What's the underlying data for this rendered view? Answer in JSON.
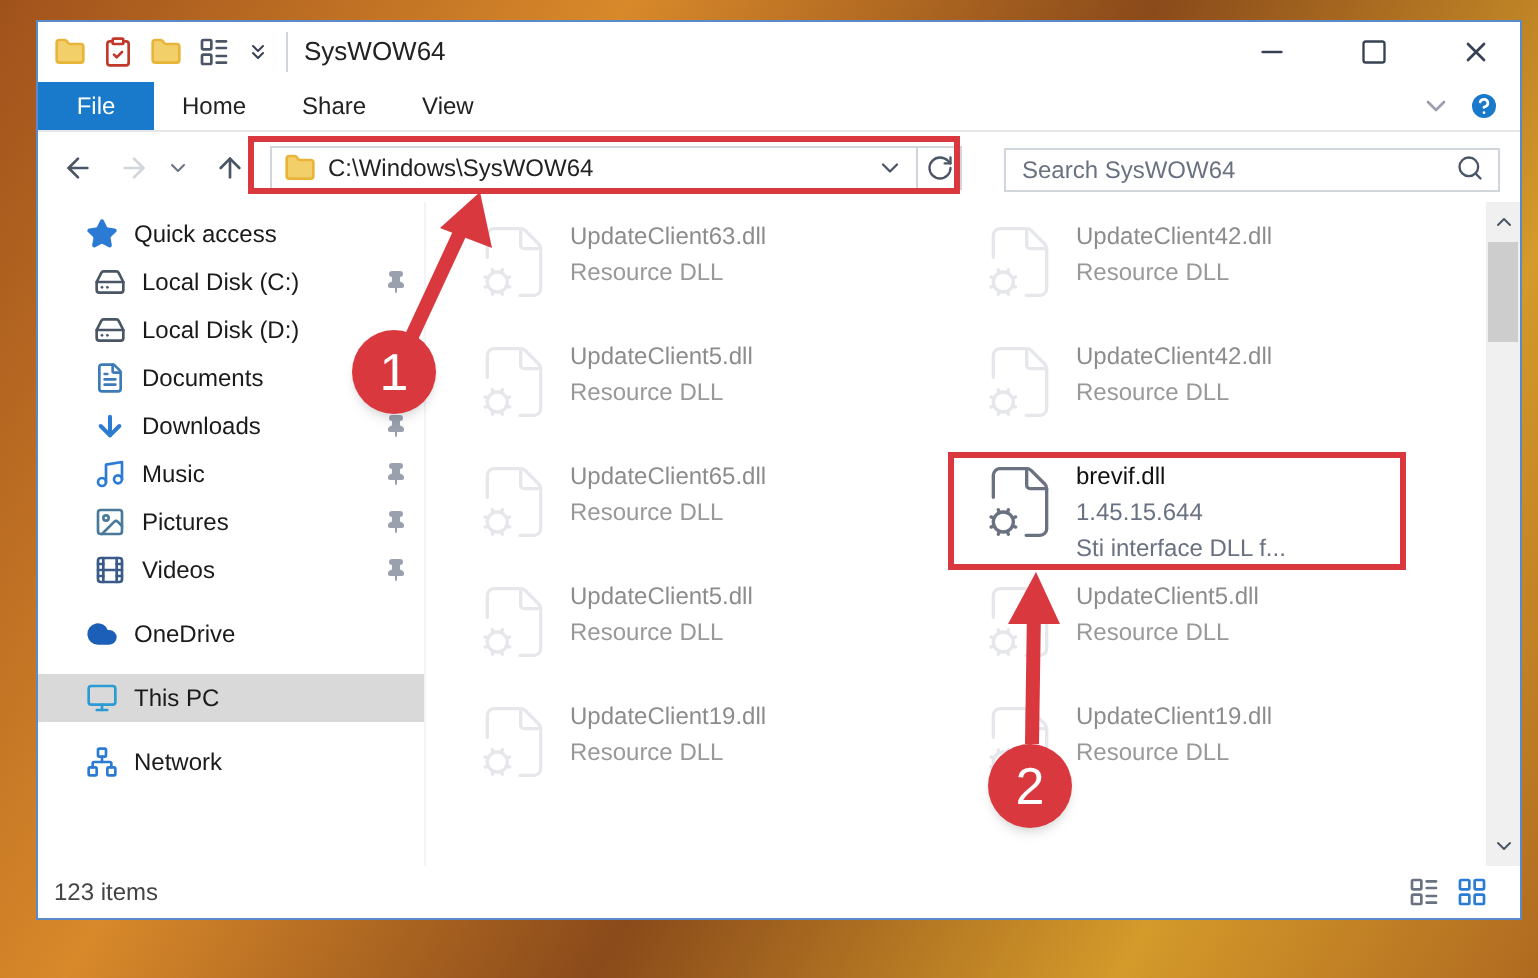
{
  "window": {
    "title": "SysWOW64"
  },
  "ribbon_tabs": [
    {
      "label": "File",
      "kind": "file"
    },
    {
      "label": "Home",
      "kind": "tab"
    },
    {
      "label": "Share",
      "kind": "tab"
    },
    {
      "label": "View",
      "kind": "tab"
    }
  ],
  "address_bar": {
    "path": "C:\\Windows\\SysWOW64"
  },
  "search": {
    "placeholder": "Search SysWOW64"
  },
  "sidebar": {
    "items": [
      {
        "label": "Quick access",
        "kind": "star",
        "selected": false,
        "children": [
          {
            "label": "Local Disk (C:)",
            "kind": "drive",
            "pinned": true,
            "selected": false
          },
          {
            "label": "Local Disk (D:)",
            "kind": "drive",
            "pinned": false,
            "selected": false
          },
          {
            "label": "Documents",
            "kind": "documents",
            "pinned": false,
            "selected": false
          },
          {
            "label": "Downloads",
            "kind": "downloads",
            "pinned": true,
            "selected": false
          },
          {
            "label": "Music",
            "kind": "music",
            "pinned": true,
            "selected": false
          },
          {
            "label": "Pictures",
            "kind": "pictures",
            "pinned": true,
            "selected": false
          },
          {
            "label": "Videos",
            "kind": "videos",
            "pinned": true,
            "selected": false
          }
        ]
      },
      {
        "label": "OneDrive",
        "kind": "cloud",
        "selected": false
      },
      {
        "label": "This PC",
        "kind": "pc",
        "selected": true
      },
      {
        "label": "Network",
        "kind": "network",
        "selected": false
      }
    ]
  },
  "files": [
    {
      "name": "UpdateClient63.dll",
      "description": "Resource DLL",
      "dimmed": true
    },
    {
      "name": "UpdateClient42.dll",
      "description": "Resource DLL",
      "dimmed": true
    },
    {
      "name": "UpdateClient5.dll",
      "description": "Resource DLL",
      "dimmed": true
    },
    {
      "name": "UpdateClient42.dll",
      "description": "Resource DLL",
      "dimmed": true
    },
    {
      "name": "UpdateClient65.dll",
      "description": "Resource DLL",
      "dimmed": true
    },
    {
      "name": "brevif.dll",
      "version": "1.45.15.644",
      "description": "Sti interface DLL f...",
      "dimmed": false
    },
    {
      "name": "UpdateClient5.dll",
      "description": "Resource DLL",
      "dimmed": true
    },
    {
      "name": "UpdateClient5.dll",
      "description": "Resource DLL",
      "dimmed": true
    },
    {
      "name": "UpdateClient19.dll",
      "description": "Resource DLL",
      "dimmed": true
    },
    {
      "name": "UpdateClient19.dll",
      "description": "Resource DLL",
      "dimmed": true
    }
  ],
  "status_bar": {
    "item_count": "123 items"
  },
  "annotations": [
    {
      "label": "1"
    },
    {
      "label": "2"
    }
  ]
}
